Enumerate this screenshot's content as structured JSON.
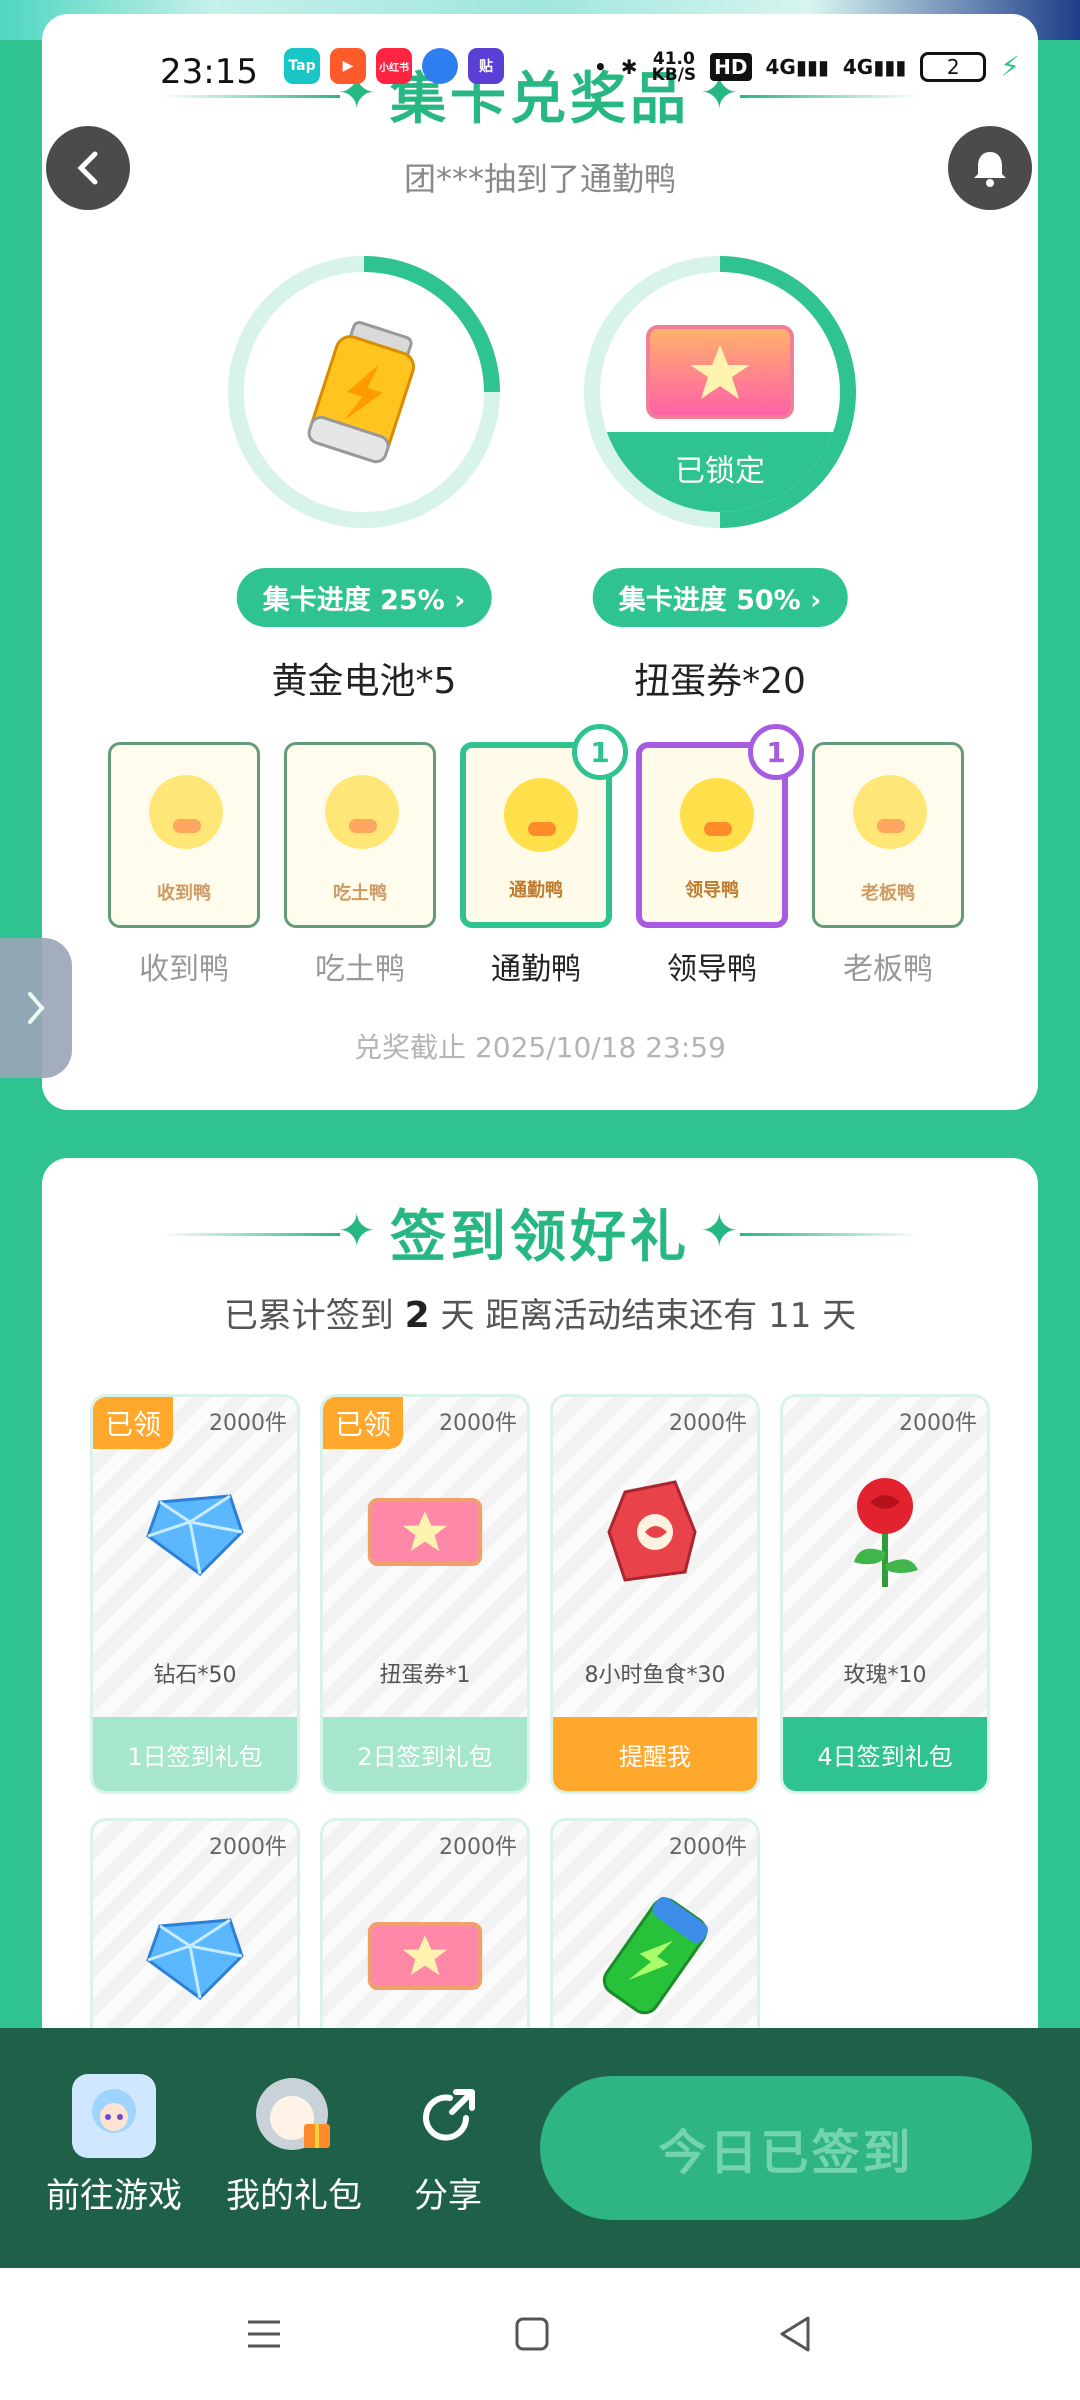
{
  "status_bar": {
    "time": "23:15",
    "apps": [
      "Tap",
      "▶",
      "小红书",
      "●",
      "贴"
    ],
    "speed_top": "41.0",
    "speed_bottom": "KB/S",
    "hd": "HD",
    "net1": "4G",
    "net2": "4G",
    "battery": "2"
  },
  "collect": {
    "title": "集卡兑奖品",
    "ticker": "团***抽到了通勤鸭",
    "prizes": [
      {
        "name": "黄金电池*5",
        "progress_label": "集卡进度 25%",
        "progress": 0.25,
        "locked": false
      },
      {
        "name": "扭蛋券*20",
        "progress_label": "集卡进度 50%",
        "progress": 0.5,
        "locked": true,
        "locked_label": "已锁定"
      }
    ],
    "ducks": [
      {
        "name": "收到鸭",
        "card_label": "收到鸭",
        "count": null,
        "state": "dim"
      },
      {
        "name": "吃土鸭",
        "card_label": "吃土鸭",
        "count": null,
        "state": "dim"
      },
      {
        "name": "通勤鸭",
        "card_label": "通勤鸭",
        "count": "1",
        "state": "green"
      },
      {
        "name": "领导鸭",
        "card_label": "领导鸭",
        "count": "1",
        "state": "purple"
      },
      {
        "name": "老板鸭",
        "card_label": "老板鸭",
        "count": null,
        "state": "dim"
      }
    ],
    "deadline": "兑奖截止 2025/10/18 23:59"
  },
  "signin": {
    "title": "签到领好礼",
    "progress_prefix": "已累计签到",
    "days": "2",
    "progress_mid": "天  距离活动结束还有 11 天",
    "gifts": [
      {
        "qty": "2000件",
        "name": "钻石*50",
        "button": "1日签到礼包",
        "claimed": "已领",
        "icon": "diamond-icon",
        "btn_color": "#a6e6cd"
      },
      {
        "qty": "2000件",
        "name": "扭蛋券*1",
        "button": "2日签到礼包",
        "claimed": "已领",
        "icon": "ticket-icon",
        "btn_color": "#a6e6cd"
      },
      {
        "qty": "2000件",
        "name": "8小时鱼食*30",
        "button": "提醒我",
        "claimed": null,
        "icon": "fish-food-bag-icon",
        "btn_color": "#ffa82b"
      },
      {
        "qty": "2000件",
        "name": "玫瑰*10",
        "button": "4日签到礼包",
        "claimed": null,
        "icon": "rose-icon",
        "btn_color": "#2fc48f"
      },
      {
        "qty": "2000件",
        "icon": "diamond-icon"
      },
      {
        "qty": "2000件",
        "icon": "ticket-icon"
      },
      {
        "qty": "2000件",
        "icon": "green-battery-icon"
      }
    ]
  },
  "bottom": {
    "go_game": "前往游戏",
    "my_gifts": "我的礼包",
    "share": "分享",
    "signed_today": "今日已签到"
  },
  "colors": {
    "primary": "#2fc48f",
    "dark": "#1e6048",
    "orange": "#ffa82b",
    "purple": "#a65be0"
  }
}
